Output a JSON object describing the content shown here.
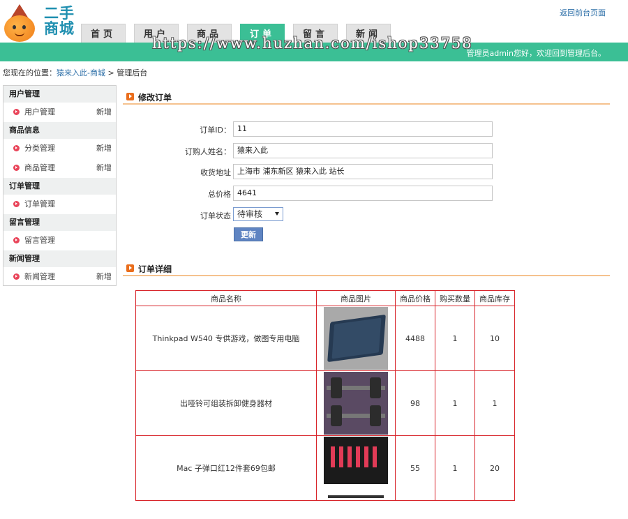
{
  "header": {
    "logo_text": "二手商城",
    "back_link": "返回前台页面",
    "welcome": "管理员admin您好，欢迎回到管理后台。",
    "watermark": "https://www.huzhan.com/ishop33758"
  },
  "nav": {
    "tabs": [
      {
        "label": "首页",
        "active": false
      },
      {
        "label": "用户",
        "active": false
      },
      {
        "label": "商品",
        "active": false
      },
      {
        "label": "订单",
        "active": true
      },
      {
        "label": "留言",
        "active": false
      },
      {
        "label": "新闻",
        "active": false
      }
    ]
  },
  "breadcrumb": {
    "prefix": "您现在的位置：",
    "link": "猿来入此-商城",
    "sep": " > ",
    "current": "管理后台"
  },
  "sidebar": {
    "groups": [
      {
        "title": "用户管理",
        "items": [
          {
            "label": "用户管理",
            "add": "新增"
          }
        ]
      },
      {
        "title": "商品信息",
        "items": [
          {
            "label": "分类管理",
            "add": "新增"
          },
          {
            "label": "商品管理",
            "add": "新增"
          }
        ]
      },
      {
        "title": "订单管理",
        "items": [
          {
            "label": "订单管理",
            "add": ""
          }
        ]
      },
      {
        "title": "留言管理",
        "items": [
          {
            "label": "留言管理",
            "add": ""
          }
        ]
      },
      {
        "title": "新闻管理",
        "items": [
          {
            "label": "新闻管理",
            "add": "新增"
          }
        ]
      }
    ]
  },
  "edit_section": {
    "title": "修改订单",
    "fields": {
      "order_id": {
        "label": "订单ID：",
        "value": "11"
      },
      "buyer_name": {
        "label": "订购人姓名：",
        "value": "猿来入此"
      },
      "address": {
        "label": "收货地址",
        "value": "上海市 浦东新区 猿来入此 站长"
      },
      "total_price": {
        "label": "总价格",
        "value": "4641"
      },
      "status": {
        "label": "订单状态",
        "value": "待审核"
      }
    },
    "update_button": "更新"
  },
  "detail_section": {
    "title": "订单详细",
    "columns": [
      "商品名称",
      "商品图片",
      "商品价格",
      "购买数量",
      "商品库存"
    ],
    "rows": [
      {
        "name": "Thinkpad W540 专供游戏，做图专用电脑",
        "image": "laptop-image",
        "price": "4488",
        "qty": "1",
        "stock": "10"
      },
      {
        "name": "出哑铃可组装拆卸健身器材",
        "image": "dumbbell-image",
        "price": "98",
        "qty": "1",
        "stock": "1"
      },
      {
        "name": "Mac 子弹口红12件套69包邮",
        "image": "lipstick-image",
        "price": "55",
        "qty": "1",
        "stock": "20"
      }
    ]
  },
  "colors": {
    "accent_green": "#3bbf95",
    "section_rule": "#f5c28e",
    "table_border": "#d8242a",
    "button_blue": "#5f84c2"
  }
}
